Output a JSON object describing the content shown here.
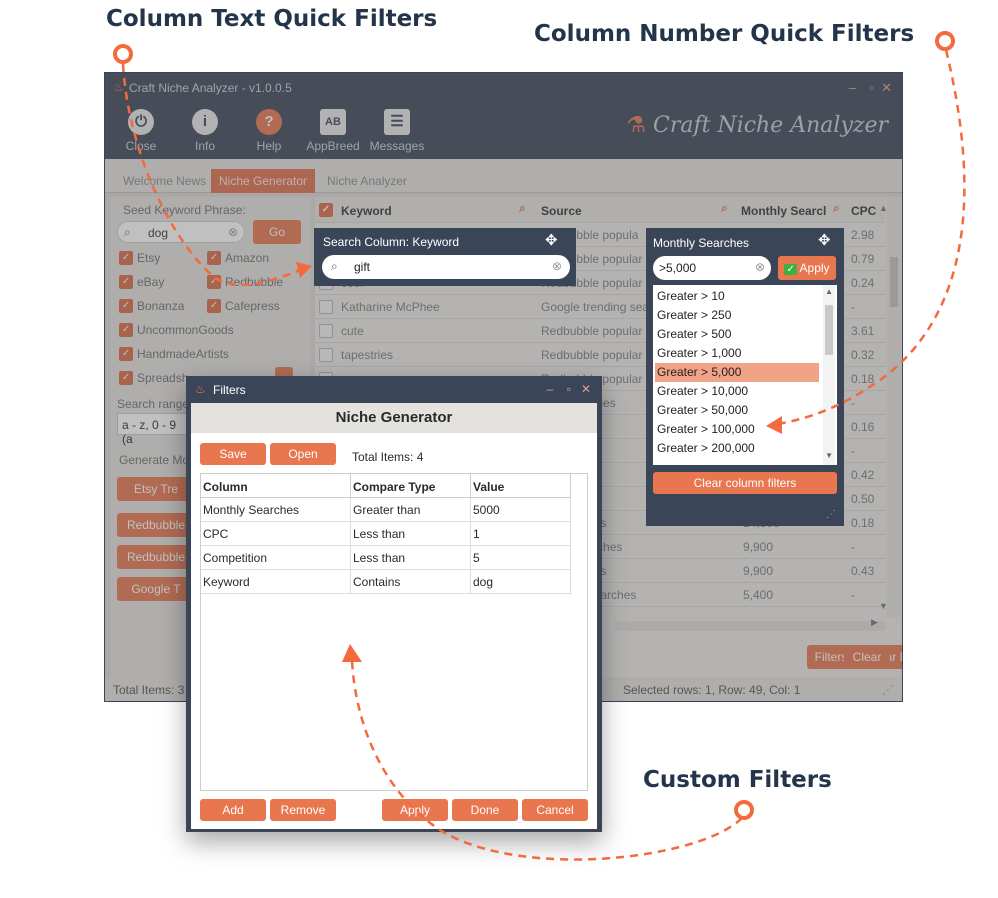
{
  "callouts": {
    "text_filters": "Column Text Quick Filters",
    "number_filters": "Column Number Quick Filters",
    "custom_filters": "Custom Filters"
  },
  "window": {
    "title": "Craft Niche Analyzer - v1.0.0.5",
    "brand": "Craft Niche Analyzer",
    "controls": [
      "–",
      "▫",
      "✕"
    ]
  },
  "toolbar": [
    {
      "label": "Close",
      "icon": "power-icon"
    },
    {
      "label": "Info",
      "icon": "info-icon"
    },
    {
      "label": "Help",
      "icon": "help-icon"
    },
    {
      "label": "AppBreed",
      "icon": "appbreed-icon"
    },
    {
      "label": "Messages",
      "icon": "messages-icon"
    }
  ],
  "tabs": [
    "Welcome News",
    "Niche Generator",
    "Niche Analyzer"
  ],
  "panel": {
    "seed_label": "Seed Keyword Phrase:",
    "seed_value": "dog",
    "go_label": "Go",
    "sources": [
      "Etsy",
      "Amazon",
      "eBay",
      "Redbubble",
      "Bonanza",
      "Cafepress",
      "UncommonGoods",
      "HandmadeArtists",
      "Spreadsh"
    ],
    "search_range_label": "Search range",
    "search_range_value": "a - z, 0 - 9 (a",
    "generate_label": "Generate Mo",
    "gen_buttons": [
      "Etsy Tre",
      "Redbubble",
      "Redbubble",
      "Google T"
    ]
  },
  "grid": {
    "headers": [
      "Keyword",
      "Source",
      "Monthly Searcl",
      "CPC"
    ],
    "rows": [
      {
        "keyword": "",
        "source": "Redbubble popula",
        "searches": "",
        "cpc": "2.98"
      },
      {
        "keyword": "",
        "source": "Redbubble popular",
        "searches": "",
        "cpc": "0.79"
      },
      {
        "keyword": "cool",
        "source": "Redbubble popular",
        "searches": "",
        "cpc": "0.24"
      },
      {
        "keyword": "Katharine McPhee",
        "source": "Google trending sea",
        "searches": "",
        "cpc": "-"
      },
      {
        "keyword": "cute",
        "source": "Redbubble popular",
        "searches": "",
        "cpc": "3.61"
      },
      {
        "keyword": "tapestries",
        "source": "Redbubble popular",
        "searches": "",
        "cpc": "0.32"
      },
      {
        "keyword": "",
        "source": "Redbubble popular",
        "searches": "",
        "cpc": "0.18"
      },
      {
        "keyword": "",
        "source": "ding searches",
        "searches": "",
        "cpc": "-"
      },
      {
        "keyword": "",
        "source": "searches",
        "searches": "",
        "cpc": "0.16"
      },
      {
        "keyword": "",
        "source": "searches",
        "searches": "",
        "cpc": "-"
      },
      {
        "keyword": "",
        "source": "searches",
        "searches": "",
        "cpc": "0.42"
      },
      {
        "keyword": "",
        "source": "trending",
        "searches": "",
        "cpc": "0.50"
      },
      {
        "keyword": "",
        "source": "ng searches",
        "searches": "14,800",
        "cpc": "0.18"
      },
      {
        "keyword": "",
        "source": "nding searches",
        "searches": "9,900",
        "cpc": "-"
      },
      {
        "keyword": "",
        "source": "ng searches",
        "searches": "9,900",
        "cpc": "0.43"
      },
      {
        "keyword": "",
        "source": "trending searches",
        "searches": "5,400",
        "cpc": "-"
      }
    ],
    "footer_buttons": [
      "Filters",
      "Clear Filters",
      "Clear"
    ]
  },
  "status": {
    "left": "Total Items: 3",
    "right": "Selected rows: 1, Row: 49, Col: 1"
  },
  "keyword_search": {
    "title": "Search Column: Keyword",
    "value": "gift"
  },
  "number_search": {
    "title": "Monthly Searches",
    "value": ">5,000",
    "apply_label": "Apply",
    "options": [
      "Greater > 10",
      "Greater > 250",
      "Greater > 500",
      "Greater > 1,000",
      "Greater > 5,000",
      "Greater > 10,000",
      "Greater > 50,000",
      "Greater > 100,000",
      "Greater > 200,000"
    ],
    "selected": "Greater > 5,000",
    "clear_label": "Clear column filters"
  },
  "filters_dialog": {
    "title": "Filters",
    "heading": "Niche Generator",
    "save_label": "Save",
    "open_label": "Open",
    "total_label": "Total Items: 4",
    "columns": [
      "Column",
      "Compare Type",
      "Value"
    ],
    "rows": [
      {
        "column": "Monthly Searches",
        "compare": "Greater than",
        "value": "5000"
      },
      {
        "column": "CPC",
        "compare": "Less than",
        "value": "1"
      },
      {
        "column": "Competition",
        "compare": "Less than",
        "value": "5"
      },
      {
        "column": "Keyword",
        "compare": "Contains",
        "value": "dog"
      }
    ],
    "buttons": [
      "Add",
      "Remove",
      "Apply",
      "Done",
      "Cancel"
    ]
  },
  "colors": {
    "accent": "#e8764f",
    "dark": "#3a4658",
    "callout": "#24344a",
    "arrow": "#f26a3d"
  }
}
